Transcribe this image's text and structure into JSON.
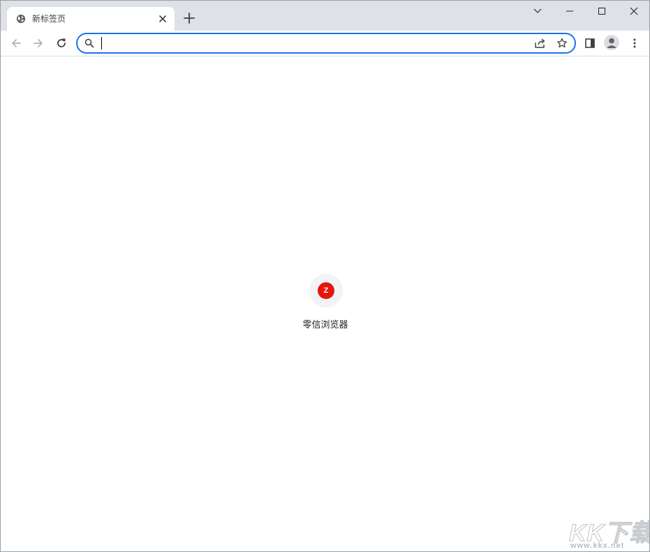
{
  "tab": {
    "title": "新标签页",
    "favicon_icon": "globe-icon",
    "close_icon": "close-icon"
  },
  "tabstrip": {
    "new_tab_icon": "plus-icon",
    "tab_search_icon": "chevron-down-icon"
  },
  "window_controls": [
    "minimize-icon",
    "maximize-icon",
    "close-icon"
  ],
  "toolbar": {
    "back_icon": "arrow-left-icon",
    "forward_icon": "arrow-right-icon",
    "reload_icon": "reload-icon",
    "side_panel_icon": "side-panel-icon",
    "profile_icon": "avatar-icon",
    "menu_icon": "kebab-menu-icon"
  },
  "omnibox": {
    "value": "",
    "placeholder": "",
    "search_icon": "search-icon",
    "share_icon": "share-icon",
    "bookmark_icon": "star-icon"
  },
  "shortcuts": [
    {
      "label": "零信浏览器",
      "favicon_letter": "Z",
      "favicon_color": "#e8150d"
    }
  ],
  "watermark": {
    "main": "KK下载",
    "sub": "www.kkx.net"
  },
  "colors": {
    "accent": "#1a73e8",
    "tabstrip_bg": "#dee1e6",
    "shortcut_tile_bg": "#f1f3f4"
  }
}
